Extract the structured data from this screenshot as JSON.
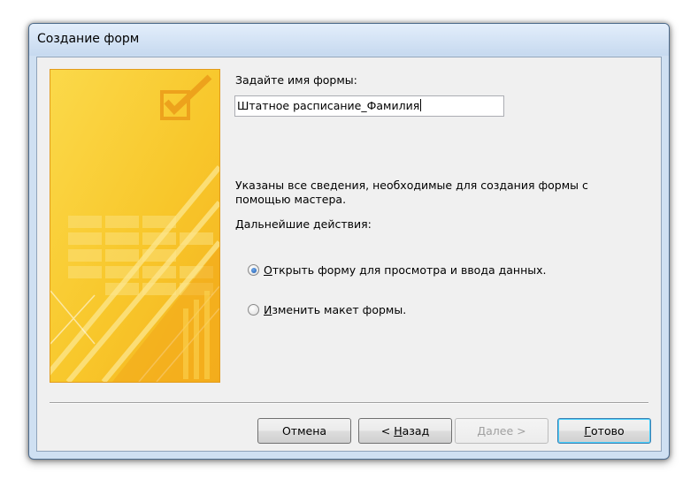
{
  "window": {
    "title": "Создание форм"
  },
  "form_name": {
    "label": "Задайте имя формы:",
    "value": "Штатное расписание_Фамилия"
  },
  "info": {
    "line1": "Указаны все сведения, необходимые для создания формы с",
    "line2": "помощью мастера."
  },
  "actions": {
    "label": "Дальнейшие действия:",
    "options": [
      {
        "mnemonic": "О",
        "rest": "ткрыть форму для просмотра и ввода данных.",
        "checked": true
      },
      {
        "mnemonic": "И",
        "rest": "зменить макет формы.",
        "checked": false
      }
    ]
  },
  "buttons": {
    "cancel": "Отмена",
    "back_prefix": "< ",
    "back_mnemonic": "Н",
    "back_rest": "азад",
    "next_mnemonic": "Д",
    "next_rest": "алее >",
    "finish_mnemonic": "Г",
    "finish_rest": "отово"
  },
  "icons": {
    "wizard_art": "form-wizard-checkbox-icon"
  },
  "colors": {
    "art_yellow": "#f8c72b",
    "art_orange": "#f0a317",
    "default_button_border": "#3c7fb1"
  }
}
